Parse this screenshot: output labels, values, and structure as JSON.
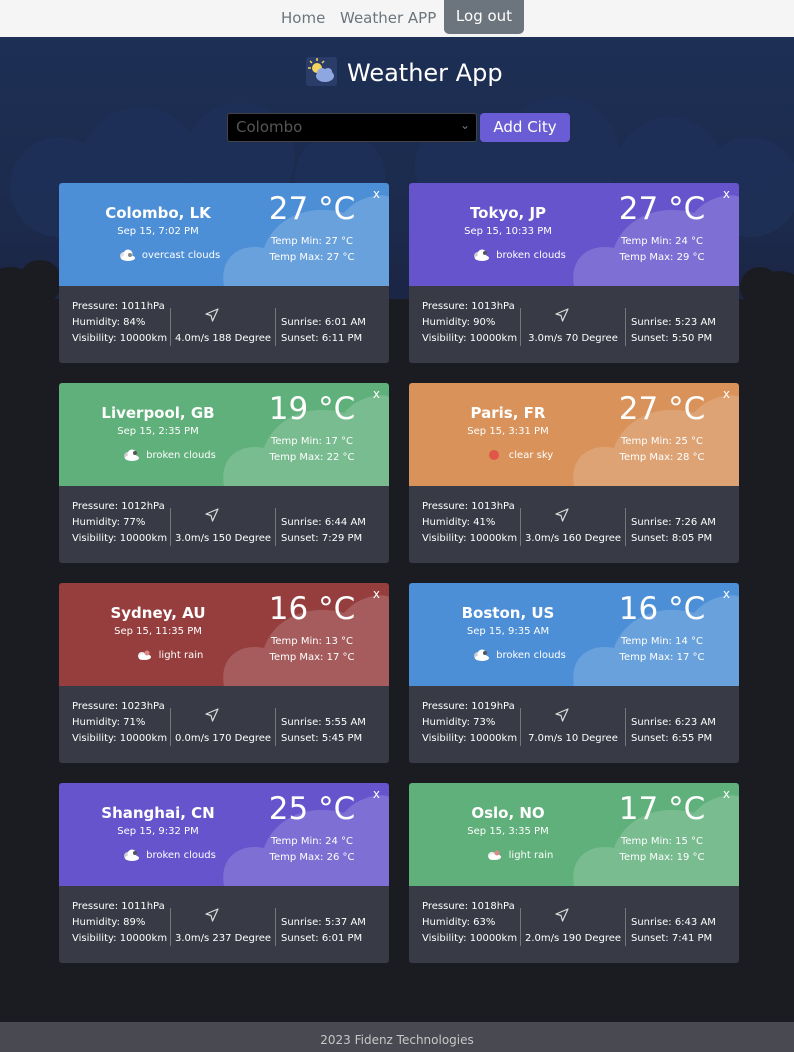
{
  "nav": {
    "home_label": "Home",
    "weather_label": "Weather APP",
    "logout_label": "Log out"
  },
  "header": {
    "title": "Weather App",
    "select_value": "Colombo",
    "add_city_label": "Add City"
  },
  "colors": {
    "blue": "#4d8fd6",
    "purple": "#6654cc",
    "green": "#5fb07a",
    "orange": "#d8925a",
    "red": "#963d3d"
  },
  "cards": [
    {
      "city": "Colombo, LK",
      "datetime": "Sep 15, 7:02 PM",
      "icon": "overcast-clouds-icon",
      "description": "overcast clouds",
      "temp": "27 °C",
      "temp_min": "Temp Min: 27 °C",
      "temp_max": "Temp Max: 27 °C",
      "pressure": "Pressure: 1011hPa",
      "humidity": "Humidity: 84%",
      "visibility": "Visibility: 10000km",
      "wind": "4.0m/s  188 Degree",
      "sunrise": "Sunrise: 6:01 AM",
      "sunset": "Sunset: 6:11 PM",
      "color": "#4d8fd6",
      "close": "x"
    },
    {
      "city": "Tokyo, JP",
      "datetime": "Sep 15, 10:33 PM",
      "icon": "broken-clouds-icon",
      "description": "broken clouds",
      "temp": "27 °C",
      "temp_min": "Temp Min: 24 °C",
      "temp_max": "Temp Max: 29 °C",
      "pressure": "Pressure: 1013hPa",
      "humidity": "Humidity: 90%",
      "visibility": "Visibility: 10000km",
      "wind": "3.0m/s  70 Degree",
      "sunrise": "Sunrise: 5:23 AM",
      "sunset": "Sunset: 5:50 PM",
      "color": "#6654cc",
      "close": "x"
    },
    {
      "city": "Liverpool, GB",
      "datetime": "Sep 15, 2:35 PM",
      "icon": "broken-clouds-icon",
      "description": "broken clouds",
      "temp": "19 °C",
      "temp_min": "Temp Min: 17 °C",
      "temp_max": "Temp Max: 22 °C",
      "pressure": "Pressure: 1012hPa",
      "humidity": "Humidity: 77%",
      "visibility": "Visibility: 10000km",
      "wind": "3.0m/s  150 Degree",
      "sunrise": "Sunrise: 6:44 AM",
      "sunset": "Sunset: 7:29 PM",
      "color": "#5fb07a",
      "close": "x"
    },
    {
      "city": "Paris, FR",
      "datetime": "Sep 15, 3:31 PM",
      "icon": "clear-sky-icon",
      "description": "clear sky",
      "temp": "27 °C",
      "temp_min": "Temp Min: 25 °C",
      "temp_max": "Temp Max: 28 °C",
      "pressure": "Pressure: 1013hPa",
      "humidity": "Humidity: 41%",
      "visibility": "Visibility: 10000km",
      "wind": "3.0m/s  160 Degree",
      "sunrise": "Sunrise: 7:26 AM",
      "sunset": "Sunset: 8:05 PM",
      "color": "#d8925a",
      "close": "x"
    },
    {
      "city": "Sydney, AU",
      "datetime": "Sep 15, 11:35 PM",
      "icon": "light-rain-icon",
      "description": "light rain",
      "temp": "16 °C",
      "temp_min": "Temp Min: 13 °C",
      "temp_max": "Temp Max: 17 °C",
      "pressure": "Pressure: 1023hPa",
      "humidity": "Humidity: 71%",
      "visibility": "Visibility: 10000km",
      "wind": "0.0m/s  170 Degree",
      "sunrise": "Sunrise: 5:55 AM",
      "sunset": "Sunset: 5:45 PM",
      "color": "#963d3d",
      "close": "x"
    },
    {
      "city": "Boston, US",
      "datetime": "Sep 15, 9:35 AM",
      "icon": "broken-clouds-icon",
      "description": "broken clouds",
      "temp": "16 °C",
      "temp_min": "Temp Min: 14 °C",
      "temp_max": "Temp Max: 17 °C",
      "pressure": "Pressure: 1019hPa",
      "humidity": "Humidity: 73%",
      "visibility": "Visibility: 10000km",
      "wind": "7.0m/s  10 Degree",
      "sunrise": "Sunrise: 6:23 AM",
      "sunset": "Sunset: 6:55 PM",
      "color": "#4d8fd6",
      "close": "x"
    },
    {
      "city": "Shanghai, CN",
      "datetime": "Sep 15, 9:32 PM",
      "icon": "broken-clouds-icon",
      "description": "broken clouds",
      "temp": "25 °C",
      "temp_min": "Temp Min: 24 °C",
      "temp_max": "Temp Max: 26 °C",
      "pressure": "Pressure: 1011hPa",
      "humidity": "Humidity: 89%",
      "visibility": "Visibility: 10000km",
      "wind": "3.0m/s  237 Degree",
      "sunrise": "Sunrise: 5:37 AM",
      "sunset": "Sunset: 6:01 PM",
      "color": "#6654cc",
      "close": "x"
    },
    {
      "city": "Oslo, NO",
      "datetime": "Sep 15, 3:35 PM",
      "icon": "light-rain-icon",
      "description": "light rain",
      "temp": "17 °C",
      "temp_min": "Temp Min: 15 °C",
      "temp_max": "Temp Max: 19 °C",
      "pressure": "Pressure: 1018hPa",
      "humidity": "Humidity: 63%",
      "visibility": "Visibility: 10000km",
      "wind": "2.0m/s  190 Degree",
      "sunrise": "Sunrise: 6:43 AM",
      "sunset": "Sunset: 7:41 PM",
      "color": "#5fb07a",
      "close": "x"
    }
  ],
  "footer": {
    "text": "2023 Fidenz Technologies"
  }
}
